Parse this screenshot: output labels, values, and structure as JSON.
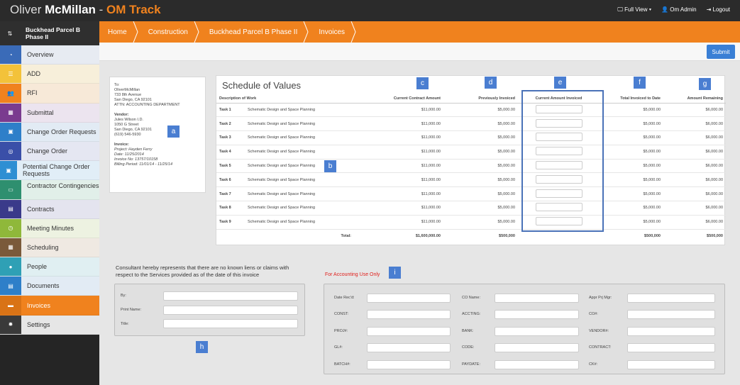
{
  "app": {
    "name_prefix": "Oliver ",
    "name_bold": "McMillan",
    "name_sep": " - ",
    "name_accent": "OM Track"
  },
  "topnav": {
    "view": "🖵 Full View ▾",
    "user": "👤 Om Admin",
    "logout": "⇥ Logout"
  },
  "sidebar": {
    "header": "Buckhead Parcel B Phase II",
    "items": [
      {
        "label": "Overview",
        "icon": "dashboard-icon",
        "color": "#3a6bb8",
        "bg": "#e7ebf2"
      },
      {
        "label": "ADD",
        "icon": "list-icon",
        "color": "#f3c23a",
        "bg": "#f7efda"
      },
      {
        "label": "RFI",
        "icon": "people-icon",
        "color": "#f0821e",
        "bg": "#f7e9d8"
      },
      {
        "label": "Submittal",
        "icon": "calendar-icon",
        "color": "#7a3b8f",
        "bg": "#ece4ef"
      },
      {
        "label": "Change Order Requests",
        "icon": "briefcase-icon",
        "color": "#2e7fc9",
        "bg": "#e2ebf4"
      },
      {
        "label": "Change Order",
        "icon": "globe-icon",
        "color": "#3a4fa8",
        "bg": "#e5e7f2"
      },
      {
        "label": "Potential Change Order Requests",
        "icon": "briefcase-icon",
        "color": "#2e8fd3",
        "bg": "#e1eef7"
      },
      {
        "label": "Contractor Contingencies",
        "icon": "money-icon",
        "color": "#2e8f6f",
        "bg": "#e1efe9"
      },
      {
        "label": "Contracts",
        "icon": "document-icon",
        "color": "#3a3a8a",
        "bg": "#e4e4ef"
      },
      {
        "label": "Meeting Minutes",
        "icon": "clock-icon",
        "color": "#8fb83a",
        "bg": "#edf2e1"
      },
      {
        "label": "Scheduling",
        "icon": "calendar-icon",
        "color": "#7a5a3a",
        "bg": "#efe9e2"
      },
      {
        "label": "People",
        "icon": "person-icon",
        "color": "#2fa0b5",
        "bg": "#e0eff2"
      },
      {
        "label": "Documents",
        "icon": "document-icon",
        "color": "#2e7fc9",
        "bg": "#e2ebf4"
      },
      {
        "label": "Invoices",
        "icon": "invoice-icon",
        "color": "#f0821e",
        "bg": "#f0821e",
        "active": true
      },
      {
        "label": "Settings",
        "icon": "gear-icon",
        "color": "#3a3a3a",
        "bg": "#e6e6e6"
      }
    ]
  },
  "breadcrumb": [
    "Home",
    "Construction",
    "Buckhead Parcel B Phase II",
    "Invoices"
  ],
  "submit_label": "Submit",
  "address": {
    "to_label": "To:",
    "to_lines": [
      "OliverMcMillan",
      "733 8th Avenue",
      "San Diego, CA 92101",
      "ATTN: ACCOUNTING DEPARTMENT"
    ],
    "vendor_label": "Vendor:",
    "vendor_lines": [
      "Jules Wilson I.D.",
      "1050 G Street",
      "San Diego, CA 92101",
      "(619) 546-5930"
    ],
    "invoice_label": "Invoice:",
    "invoice_lines": [
      "Project: Hayden Ferry",
      "Date: 11/25/2014",
      "Invoice No: 13757/10158",
      "Billing Period: 11/01/14 - 11/25/14"
    ]
  },
  "sov": {
    "title": "Schedule of Values",
    "headers": [
      "Description of Work",
      "",
      "Current Contract Amount",
      "Previously Invoiced",
      "Current Amount Invoiced",
      "Total Invoiced to Date",
      "Amount Remaining"
    ],
    "rows": [
      [
        "Task 1",
        "Schematic Design and Space Planning",
        "$11,000.00",
        "$5,000.00",
        "$5,000.00",
        "$6,000.00"
      ],
      [
        "Task 2",
        "Schematic Design and Space Planning",
        "$11,000.00",
        "$5,000.00",
        "$5,000.00",
        "$6,000.00"
      ],
      [
        "Task 3",
        "Schematic Design and Space Planning",
        "$11,000.00",
        "$5,000.00",
        "$5,000.00",
        "$6,000.00"
      ],
      [
        "Task 4",
        "Schematic Design and Space Planning",
        "$11,000.00",
        "$5,000.00",
        "$5,000.00",
        "$6,000.00"
      ],
      [
        "Task 5",
        "Schematic Design and Space Planning",
        "$11,000.00",
        "$5,000.00",
        "$5,000.00",
        "$6,000.00"
      ],
      [
        "Task 6",
        "Schematic Design and Space Planning",
        "$11,000.00",
        "$5,000.00",
        "$5,000.00",
        "$6,000.00"
      ],
      [
        "Task 7",
        "Schematic Design and Space Planning",
        "$11,000.00",
        "$5,000.00",
        "$5,000.00",
        "$6,000.00"
      ],
      [
        "Task 8",
        "Schematic Design and Space Planning",
        "$11,000.00",
        "$5,000.00",
        "$5,000.00",
        "$6,000.00"
      ],
      [
        "Task 9",
        "Schematic Design and Space Planning",
        "$11,000.00",
        "$5,000.00",
        "$5,000.00",
        "$6,000.00"
      ]
    ],
    "total": {
      "label": "Total:",
      "contract": "$1,600,000.00",
      "previous": "$500,000",
      "to_date": "$500,000",
      "remaining": "$500,000"
    }
  },
  "badges": {
    "a": "a",
    "b": "b",
    "c": "c",
    "d": "d",
    "e": "e",
    "f": "f",
    "g": "g",
    "h": "h",
    "i": "i"
  },
  "consultant": {
    "statement": "Consultant hereby represents that there are no known liens or claims with respect to the Services provided as of the date of this invoice",
    "fields": [
      "By:",
      "Print Name:",
      "Title:"
    ]
  },
  "accounting": {
    "title": "For Accounting Use Only",
    "col1": [
      "Date Rec'd:",
      "CONST:",
      "PROJ#:",
      "GL#:",
      "BATCH#:"
    ],
    "col2": [
      "CO Name:",
      "ACCTING:",
      "BANK:",
      "CODE:",
      "PAYDATE:"
    ],
    "col3": [
      "Appr Prj Mgr:",
      "CO#:",
      "VENDOR#:",
      "CONTRACT:",
      "CK#:"
    ]
  }
}
